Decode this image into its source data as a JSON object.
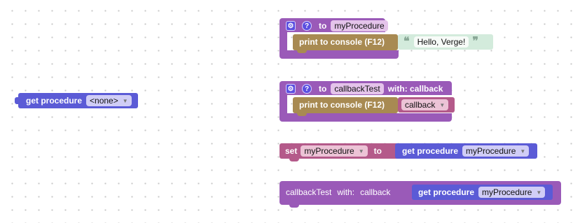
{
  "left_block": {
    "label": "get procedure",
    "dropdown": "<none>"
  },
  "proc1": {
    "gear": "⚙",
    "help": "?",
    "to": "to",
    "name": "myProcedure",
    "print_label": "print to console (F12)",
    "string": "Hello, Verge!"
  },
  "proc2": {
    "gear": "⚙",
    "help": "?",
    "to": "to",
    "name": "callbackTest",
    "with": "with: callback",
    "print_label": "print to console (F12)",
    "arg": "callback"
  },
  "set_block": {
    "set": "set",
    "var": "myProcedure",
    "to": "to",
    "get_label": "get procedure",
    "get_value": "myProcedure"
  },
  "call_block": {
    "name": "callbackTest",
    "with": "with:",
    "arg": "callback",
    "get_label": "get procedure",
    "get_value": "myProcedure"
  },
  "colors": {
    "procedure": "#9a5ab8",
    "get_procedure": "#5b5bd6",
    "print": "#a88a52",
    "variable": "#b45a8a",
    "text": "#d3ebdc"
  }
}
